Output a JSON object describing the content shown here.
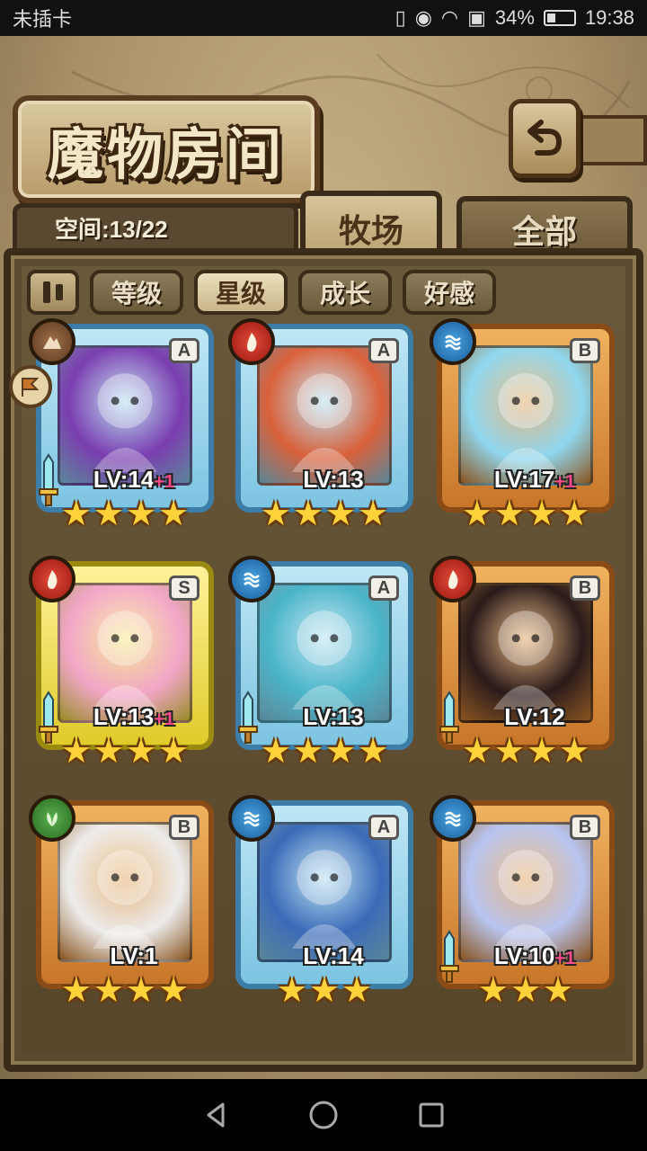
{
  "status_bar": {
    "carrier": "未插卡",
    "battery": "34%",
    "battery_level": 0.34,
    "time": "19:38"
  },
  "header": {
    "title": "魔物房间",
    "capacity": "空间:13/22"
  },
  "tabs": [
    {
      "label": "牧场",
      "active": true
    },
    {
      "label": "全部",
      "active": false
    }
  ],
  "filters": [
    {
      "label": "等级",
      "active": false
    },
    {
      "label": "星级",
      "active": true
    },
    {
      "label": "成长",
      "active": false
    },
    {
      "label": "好感",
      "active": false
    }
  ],
  "monsters": [
    {
      "rank": "A",
      "element": "earth",
      "lv_label": "LV:14",
      "bonus": "+1",
      "stars": 4,
      "equipped": true,
      "art": "#7a3db0"
    },
    {
      "rank": "A",
      "element": "fire",
      "lv_label": "LV:13",
      "bonus": "",
      "stars": 4,
      "equipped": false,
      "art": "#d9603a"
    },
    {
      "rank": "B",
      "element": "water",
      "lv_label": "LV:17",
      "bonus": "+1",
      "stars": 4,
      "equipped": false,
      "art": "#8fd7ef"
    },
    {
      "rank": "S",
      "element": "fire",
      "lv_label": "LV:13",
      "bonus": "+1",
      "stars": 4,
      "equipped": true,
      "art": "#f2a6c8"
    },
    {
      "rank": "A",
      "element": "water",
      "lv_label": "LV:13",
      "bonus": "",
      "stars": 4,
      "equipped": true,
      "art": "#4ab4c8"
    },
    {
      "rank": "B",
      "element": "fire",
      "lv_label": "LV:12",
      "bonus": "",
      "stars": 4,
      "equipped": true,
      "art": "#2a1a1a"
    },
    {
      "rank": "B",
      "element": "wood",
      "lv_label": "LV:1",
      "bonus": "",
      "stars": 4,
      "equipped": false,
      "art": "#ececec"
    },
    {
      "rank": "A",
      "element": "water",
      "lv_label": "LV:14",
      "bonus": "",
      "stars": 3,
      "equipped": false,
      "art": "#3a6ab8"
    },
    {
      "rank": "B",
      "element": "water",
      "lv_label": "LV:10",
      "bonus": "+1",
      "stars": 3,
      "equipped": true,
      "art": "#b8c4f0"
    }
  ]
}
